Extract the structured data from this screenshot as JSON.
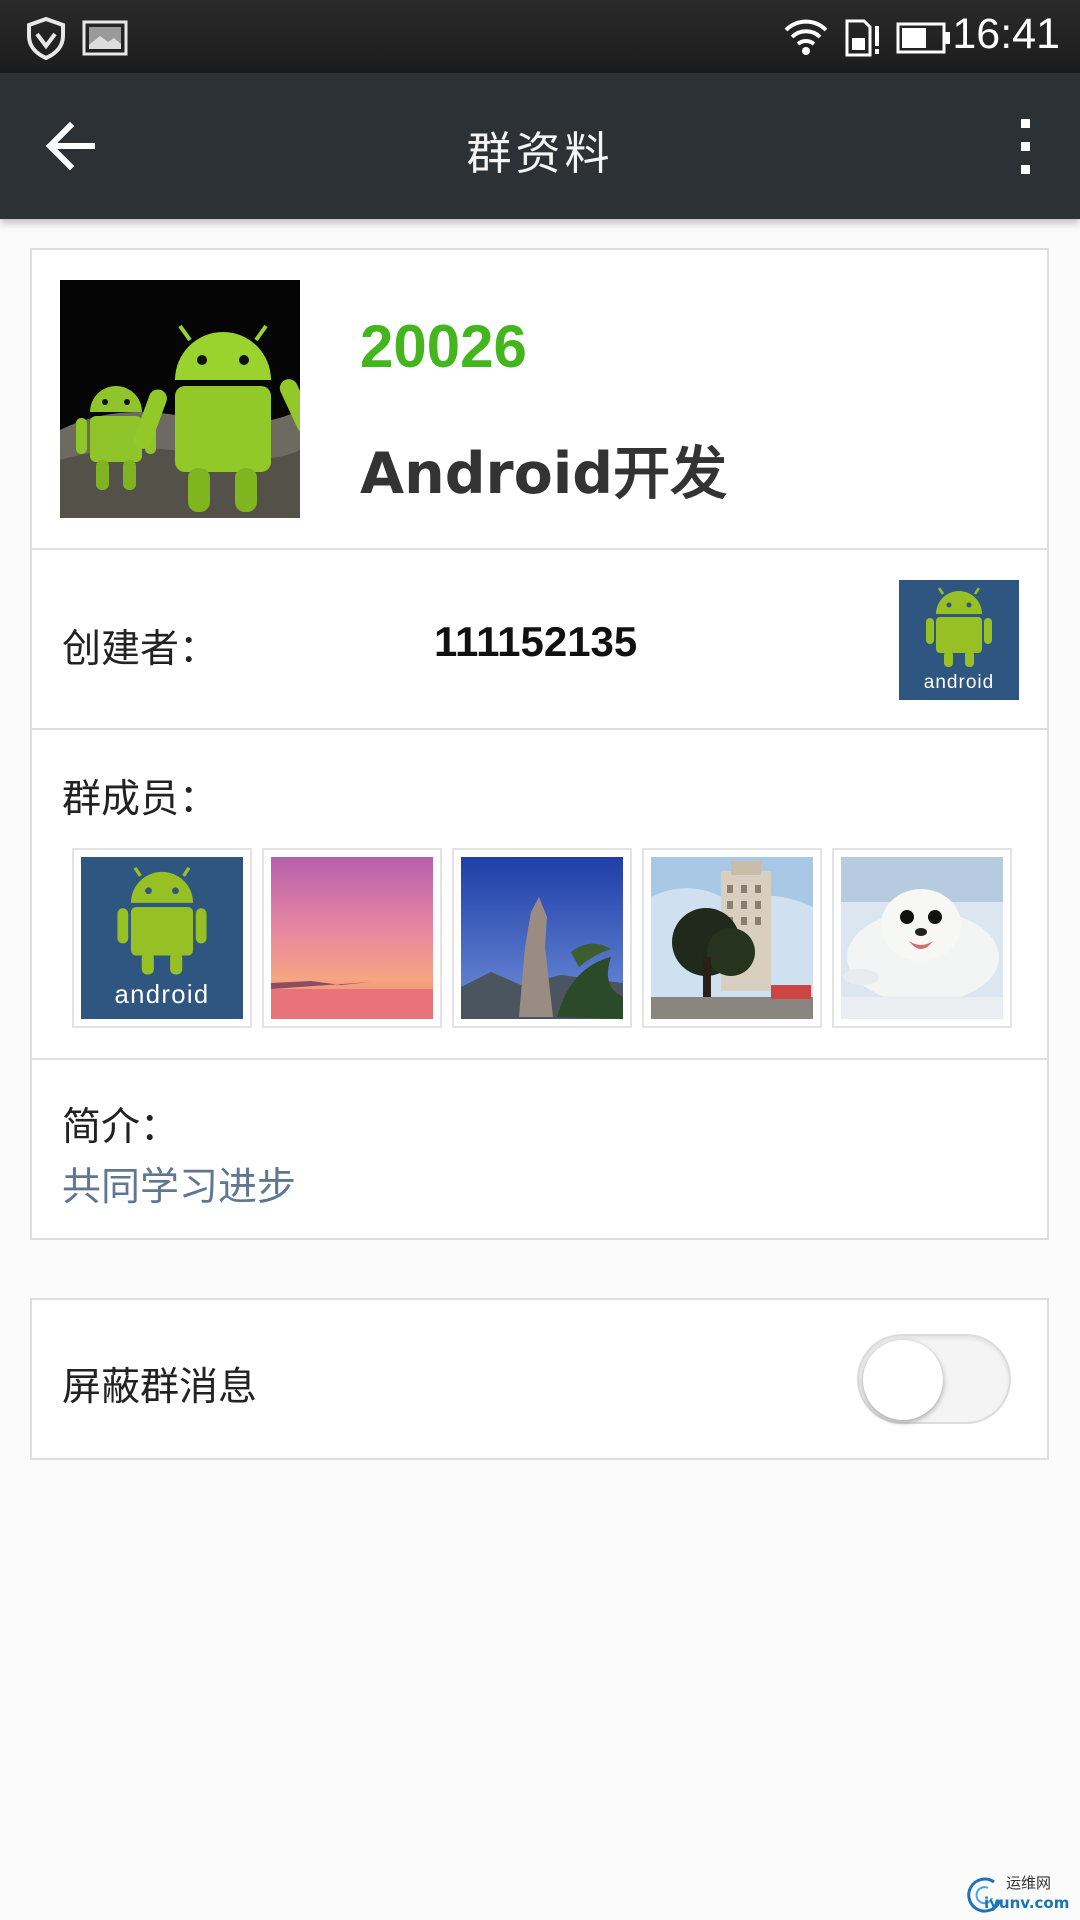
{
  "status_bar": {
    "time": "16:41",
    "icons": [
      "shield-icon",
      "image-icon",
      "wifi-icon",
      "sim-card-icon",
      "battery-icon"
    ]
  },
  "action_bar": {
    "title": "群资料",
    "back_icon": "back-arrow-icon",
    "menu_icon": "more-vertical-icon"
  },
  "group": {
    "id": "20026",
    "name": "Android开发"
  },
  "creator": {
    "label": "创建者：",
    "id": "111152135",
    "avatar_wordmark": "android"
  },
  "members": {
    "label": "群成员：",
    "items": [
      {
        "avatar": "android-logo",
        "wordmark": "android"
      },
      {
        "avatar": "pink-sunset"
      },
      {
        "avatar": "mountain-peak"
      },
      {
        "avatar": "building-tree"
      },
      {
        "avatar": "seal-pup"
      }
    ]
  },
  "intro": {
    "label": "简介：",
    "text": "共同学习进步"
  },
  "settings": {
    "mute_label": "屏蔽群消息",
    "mute_enabled": false
  },
  "watermark": {
    "line1": "运维网",
    "line2": "iyunv.com"
  },
  "colors": {
    "accent_green": "#43b51d",
    "action_bar": "#2c3135",
    "intro_text": "#5f7792",
    "android_tile": "#2f5680",
    "android_green": "#97c024"
  }
}
